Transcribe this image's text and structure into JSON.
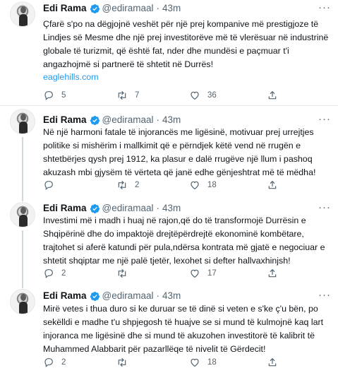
{
  "tweets": [
    {
      "author_name": "Edi Rama",
      "handle": "@ediramaal",
      "separator": "·",
      "time": "43m",
      "text": "Çfarë s'po na dëgjojnë veshët për një prej kompanive më prestigjoze të\nLindjes së Mesme dhe një prej investitorëve më të vlerësuar në industrinë\nglobale të turizmit, që është fat, nder dhe mundësi e paçmuar t'i\nangazhojmë si partnerë të shtetit në Durrës!",
      "link": "eaglehills.com",
      "replies": "5",
      "retweets": "7",
      "likes": "36"
    },
    {
      "author_name": "Edi Rama",
      "handle": "@ediramaal",
      "separator": "·",
      "time": "43m",
      "text": "Në një harmoni fatale të injorancës me ligësinë, motivuar prej urrejtjes\npolitike si mishërim i mallkimit që e përndjek këtë vend në rrugën e\nshtetbërjes qysh prej 1912, ka plasur e dalë rrugëve një llum i pashoq\nakuzash mbi gjysëm të vërteta që janë edhe gënjeshtrat më të mëdha!",
      "link": "",
      "replies": "",
      "retweets": "2",
      "likes": "18"
    },
    {
      "author_name": "Edi Rama",
      "handle": "@ediramaal",
      "separator": "·",
      "time": "43m",
      "text": "Investimi më i madh i huaj në rajon,që do të transformojë Durrësin e\nShqipërinë dhe do impaktojë drejtëpërdrejtë ekonominë kombëtare,\ntrajtohet si aferë katundi për pula,ndërsa kontrata më gjatë e negociuar e\nshtetit shqiptar me një palë tjetër, lexohet si defter hallvaxhinjsh!",
      "link": "",
      "replies": "2",
      "retweets": "",
      "likes": "17"
    },
    {
      "author_name": "Edi Rama",
      "handle": "@ediramaal",
      "separator": "·",
      "time": "43m",
      "text": "Mirë vetes i thua duro si ke duruar se të dinë si veten e s'ke ç'u bën, po\nsekëlldi e madhe t'u shpjegosh të huajve se si mund të kulmojnë kaq lart\ninjoranca me ligësinë dhe si mund të akuzohen investitorë të kalibrit të\nMuhammed Alabbarit për pazarllëqe të nivelit të Gërdecit!",
      "link": "",
      "replies": "2",
      "retweets": "",
      "likes": "18"
    }
  ],
  "colors": {
    "accent": "#1d9bf0",
    "muted": "#536471",
    "text": "#0f1419",
    "divider": "#e6ecf0"
  },
  "icons": {
    "verified": "verified-badge-icon",
    "more": "more-icon",
    "reply": "reply-icon",
    "retweet": "retweet-icon",
    "like": "like-icon",
    "share": "share-icon"
  }
}
